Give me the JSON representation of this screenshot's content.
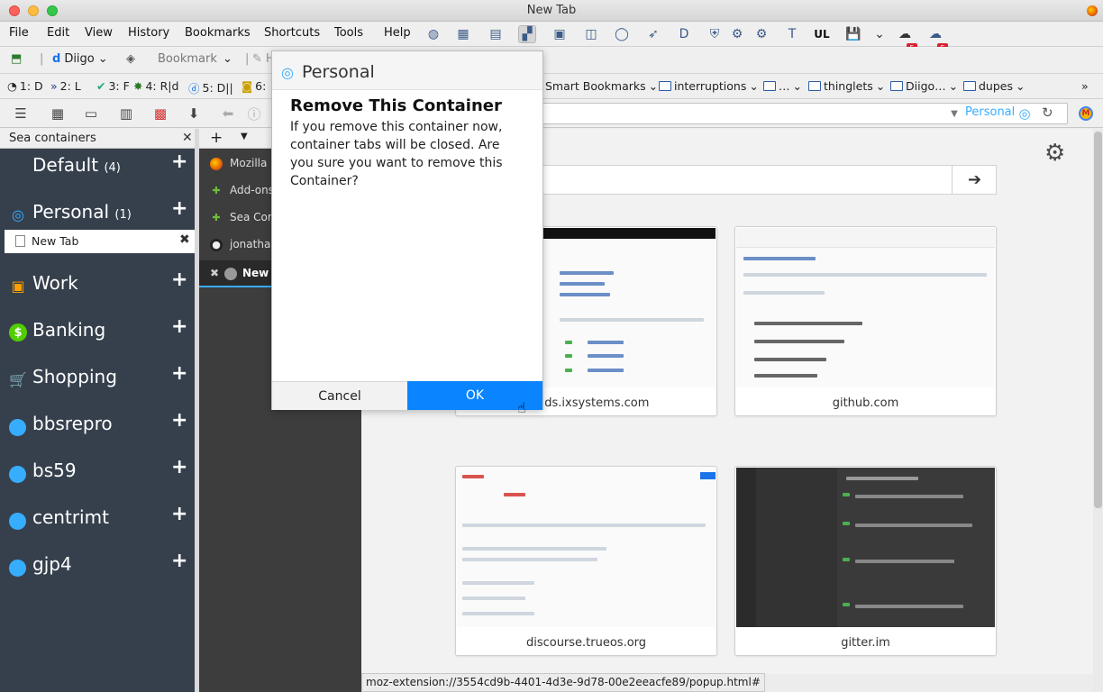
{
  "window": {
    "title": "New Tab"
  },
  "menu": {
    "file": "File",
    "edit": "Edit",
    "view": "View",
    "history": "History",
    "bookmarks": "Bookmarks",
    "shortcuts": "Shortcuts",
    "tools": "Tools",
    "help": "Help",
    "toolbar_label": "UL",
    "badge_a": "5",
    "badge_b": "5"
  },
  "toolbar2": {
    "diigo": "Diigo",
    "bookmark": "Bookmark",
    "hi": "Hi"
  },
  "bookmarks_bar": {
    "items": [
      "1: D",
      "2: L",
      "3: F",
      "4: R|d",
      "5: D||",
      "6:"
    ],
    "smart": "Smart Bookmarks",
    "folders": [
      "interruptions",
      "…",
      "thinglets",
      "Diigo…",
      "dupes"
    ]
  },
  "navbar": {
    "container_label": "Personal"
  },
  "sidebar": {
    "title": "Sea containers",
    "containers": [
      {
        "name": "Default",
        "count": "(4)"
      },
      {
        "name": "Personal",
        "count": "(1)"
      },
      {
        "name": "Work",
        "count": ""
      },
      {
        "name": "Banking",
        "count": ""
      },
      {
        "name": "Shopping",
        "count": ""
      },
      {
        "name": "bbsrepro",
        "count": ""
      },
      {
        "name": "bs59",
        "count": ""
      },
      {
        "name": "centrimt",
        "count": ""
      },
      {
        "name": "gjp4",
        "count": ""
      }
    ],
    "tab": "New Tab"
  },
  "tabs": {
    "items": [
      "Mozilla F",
      "Add-ons",
      "Sea Con",
      "jonathan",
      "New T"
    ]
  },
  "tiles": [
    {
      "label": "builds.ixsystems.com"
    },
    {
      "label": "github.com"
    },
    {
      "label": "discourse.trueos.org"
    },
    {
      "label": "gitter.im"
    }
  ],
  "dialog": {
    "container": "Personal",
    "title": "Remove This Container",
    "message": "If you remove this container now, container tabs will be closed. Are you sure you want to remove this Container?",
    "cancel": "Cancel",
    "ok": "OK"
  },
  "statusbar": {
    "text": "moz-extension://3554cd9b-4401-4d3e-9d78-00e2eeacfe89/popup.html#"
  },
  "colors": {
    "accent": "#0a84ff",
    "personal": "#37adff",
    "sidebar_bg": "#36404d",
    "work": "#ff9f00",
    "banking": "#51cd00",
    "shopping": "#ff4bda"
  }
}
